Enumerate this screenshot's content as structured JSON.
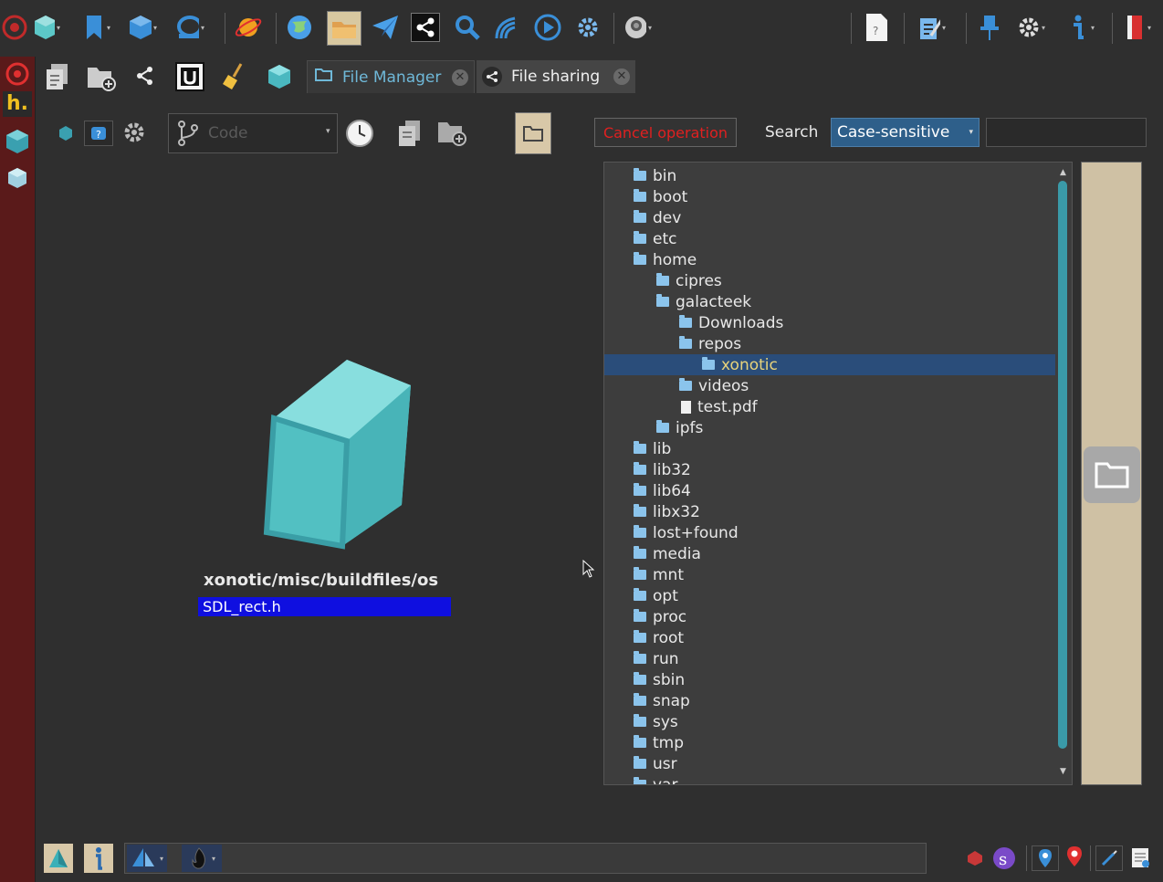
{
  "tabs": {
    "file_manager": "File Manager",
    "file_sharing": "File sharing",
    "close_glyph": "✕"
  },
  "controls": {
    "code_placeholder": "Code",
    "cancel_operation": "Cancel operation",
    "search_label": "Search",
    "case_option": "Case-sensitive"
  },
  "sidebar": {
    "h_logo": "h."
  },
  "preview": {
    "path": "xonotic/misc/buildfiles/os",
    "filename": "SDL_rect.h"
  },
  "tree": {
    "items": [
      {
        "label": "bin",
        "depth": 0,
        "type": "folder"
      },
      {
        "label": "boot",
        "depth": 0,
        "type": "folder"
      },
      {
        "label": "dev",
        "depth": 0,
        "type": "folder"
      },
      {
        "label": "etc",
        "depth": 0,
        "type": "folder"
      },
      {
        "label": "home",
        "depth": 0,
        "type": "folder"
      },
      {
        "label": "cipres",
        "depth": 1,
        "type": "folder"
      },
      {
        "label": "galacteek",
        "depth": 1,
        "type": "folder"
      },
      {
        "label": "Downloads",
        "depth": 2,
        "type": "folder"
      },
      {
        "label": "repos",
        "depth": 2,
        "type": "folder"
      },
      {
        "label": "xonotic",
        "depth": 3,
        "type": "folder",
        "selected": true
      },
      {
        "label": "videos",
        "depth": 2,
        "type": "folder"
      },
      {
        "label": "test.pdf",
        "depth": 2,
        "type": "file"
      },
      {
        "label": "ipfs",
        "depth": 1,
        "type": "folder"
      },
      {
        "label": "lib",
        "depth": 0,
        "type": "folder"
      },
      {
        "label": "lib32",
        "depth": 0,
        "type": "folder"
      },
      {
        "label": "lib64",
        "depth": 0,
        "type": "folder"
      },
      {
        "label": "libx32",
        "depth": 0,
        "type": "folder"
      },
      {
        "label": "lost+found",
        "depth": 0,
        "type": "folder"
      },
      {
        "label": "media",
        "depth": 0,
        "type": "folder"
      },
      {
        "label": "mnt",
        "depth": 0,
        "type": "folder"
      },
      {
        "label": "opt",
        "depth": 0,
        "type": "folder"
      },
      {
        "label": "proc",
        "depth": 0,
        "type": "folder"
      },
      {
        "label": "root",
        "depth": 0,
        "type": "folder"
      },
      {
        "label": "run",
        "depth": 0,
        "type": "folder"
      },
      {
        "label": "sbin",
        "depth": 0,
        "type": "folder"
      },
      {
        "label": "snap",
        "depth": 0,
        "type": "folder"
      },
      {
        "label": "sys",
        "depth": 0,
        "type": "folder"
      },
      {
        "label": "tmp",
        "depth": 0,
        "type": "folder"
      },
      {
        "label": "usr",
        "depth": 0,
        "type": "folder"
      },
      {
        "label": "var",
        "depth": 0,
        "type": "folder"
      }
    ]
  },
  "colors": {
    "selection": "#2a4d7a",
    "cancel_text": "#e02020",
    "filename_bg": "#0f0fe0",
    "sidebar": "#5a1a1a",
    "cube": "#5cc8c8"
  }
}
